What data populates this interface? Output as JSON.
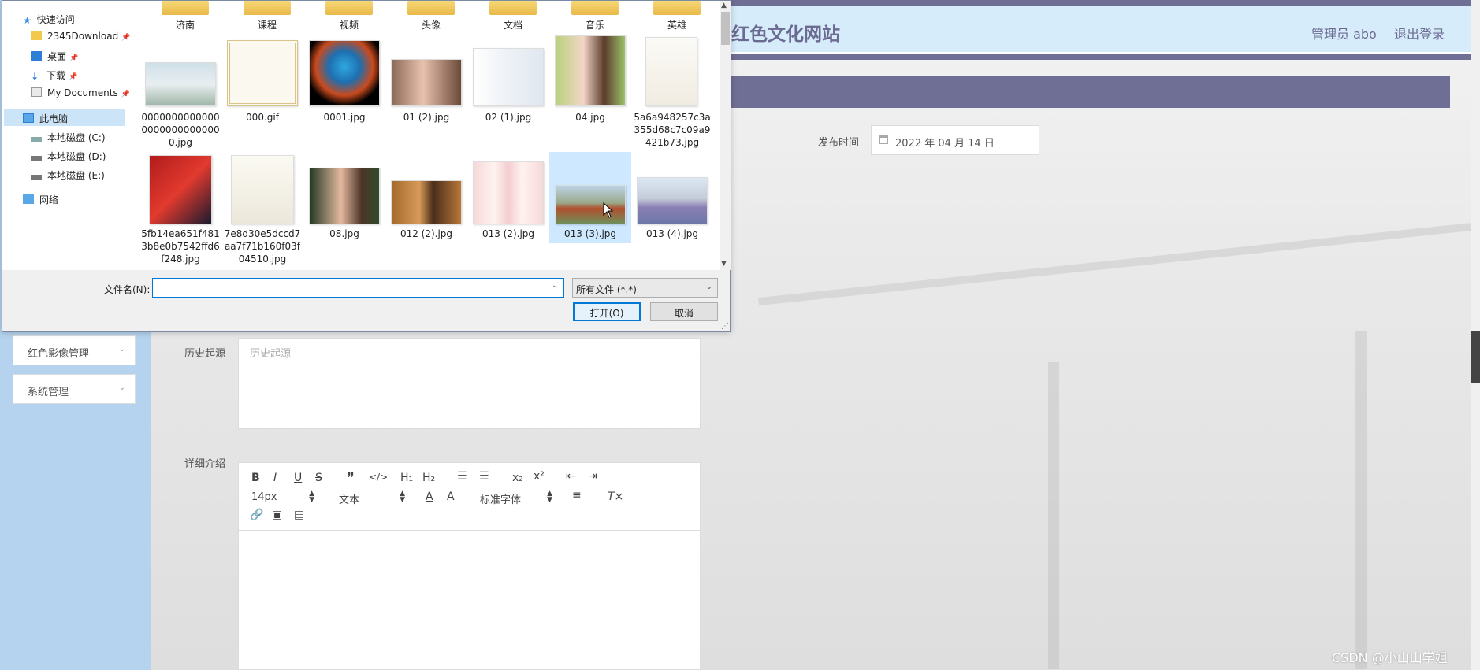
{
  "header": {
    "site_title": "红色文化网站",
    "admin_label": "管理员 abo",
    "logout_label": "退出登录"
  },
  "form": {
    "pubtime_label": "发布时间",
    "pubtime_value": "2022 年 04 月 14 日",
    "history_label": "历史起源",
    "history_placeholder": "历史起源",
    "detail_label": "详细介绍"
  },
  "sidebar": {
    "items": [
      {
        "label": "红色影像管理"
      },
      {
        "label": "系统管理"
      }
    ]
  },
  "editor": {
    "font_size": "14px",
    "block_type": "文本",
    "font_family": "标准字体"
  },
  "dialog": {
    "nav": [
      {
        "label": "快速访问"
      },
      {
        "label": "2345Download"
      },
      {
        "label": "桌面"
      },
      {
        "label": "下载"
      },
      {
        "label": "My Documents"
      },
      {
        "label": "此电脑"
      },
      {
        "label": "本地磁盘 (C:)"
      },
      {
        "label": "本地磁盘 (D:)"
      },
      {
        "label": "本地磁盘 (E:)"
      },
      {
        "label": "网络"
      }
    ],
    "folders": [
      "济南",
      "课程",
      "视频",
      "头像",
      "文档",
      "音乐",
      "英雄"
    ],
    "files_row1": [
      {
        "name": "000000000000000000000000000.jpg"
      },
      {
        "name": "000.gif"
      },
      {
        "name": "0001.jpg"
      },
      {
        "name": "01 (2).jpg"
      },
      {
        "name": "02 (1).jpg"
      },
      {
        "name": "04.jpg"
      },
      {
        "name": "5a6a948257c3a355d68c7c09a9421b73.jpg"
      }
    ],
    "files_row2": [
      {
        "name": "5fb14ea651f4813b8e0b7542ffd6f248.jpg"
      },
      {
        "name": "7e8d30e5dccd7aa7f71b160f03f04510.jpg"
      },
      {
        "name": "08.jpg"
      },
      {
        "name": "012 (2).jpg"
      },
      {
        "name": "013 (2).jpg"
      },
      {
        "name": "013 (3).jpg"
      },
      {
        "name": "013 (4).jpg"
      }
    ],
    "filename_label": "文件名(N):",
    "filename_value": "",
    "filetype_value": "所有文件 (*.*)",
    "open_label": "打开(O)",
    "cancel_label": "取消"
  },
  "watermark": "CSDN @小山山学姐"
}
